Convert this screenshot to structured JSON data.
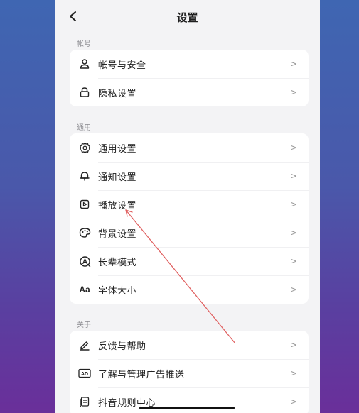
{
  "header": {
    "title": "设置",
    "back_icon": "chevron-left-icon"
  },
  "sections": [
    {
      "label": "帐号",
      "items": [
        {
          "label": "帐号与安全",
          "icon": "person-icon"
        },
        {
          "label": "隐私设置",
          "icon": "lock-icon"
        }
      ]
    },
    {
      "label": "通用",
      "items": [
        {
          "label": "通用设置",
          "icon": "gear-icon"
        },
        {
          "label": "通知设置",
          "icon": "bell-icon"
        },
        {
          "label": "播放设置",
          "icon": "play-icon"
        },
        {
          "label": "背景设置",
          "icon": "palette-icon"
        },
        {
          "label": "长辈模式",
          "icon": "elder-mode-icon"
        },
        {
          "label": "字体大小",
          "icon": "font-size-icon",
          "glyph": "Aa"
        }
      ]
    },
    {
      "label": "关于",
      "items": [
        {
          "label": "反馈与帮助",
          "icon": "pen-icon"
        },
        {
          "label": "了解与管理广告推送",
          "icon": "ad-icon",
          "glyph": "AD"
        },
        {
          "label": "抖音规则中心",
          "icon": "rules-icon"
        }
      ]
    }
  ],
  "chevron": ">",
  "colors": {
    "annotation": "#e06060",
    "background_top": "#3f66b2",
    "background_bottom": "#6a2f9a"
  }
}
